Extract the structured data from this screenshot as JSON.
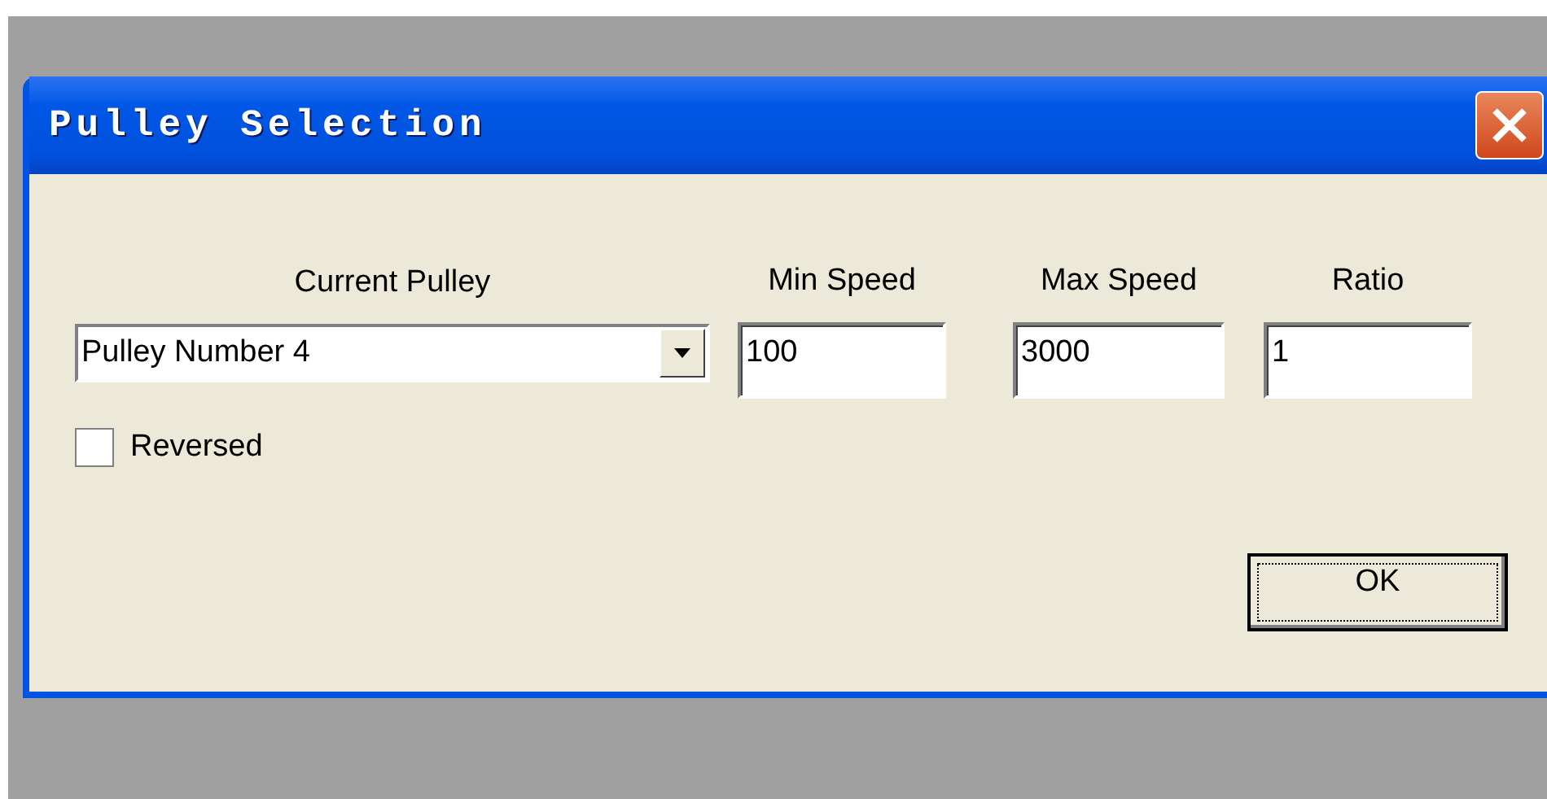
{
  "window": {
    "title": "Pulley Selection"
  },
  "current_pulley": {
    "label": "Current Pulley",
    "value": "Pulley Number 4"
  },
  "fields": [
    {
      "label": "Min Speed",
      "value": "100"
    },
    {
      "label": "Max Speed",
      "value": "3000"
    },
    {
      "label": "Ratio",
      "value": "1"
    }
  ],
  "reversed": {
    "label": "Reversed",
    "checked": false
  },
  "buttons": [
    {
      "label": "OK",
      "focused": true
    }
  ]
}
